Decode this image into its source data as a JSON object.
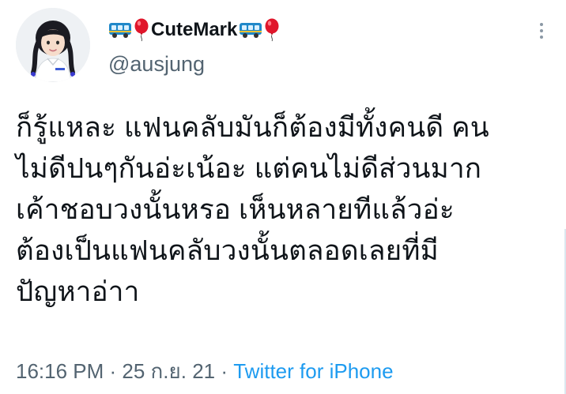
{
  "author": {
    "display_name": "CuteMark",
    "handle": "@ausjung",
    "name_emojis": [
      "bus-icon",
      "balloon-icon"
    ]
  },
  "tweet": {
    "lines": [
      "ก็รู้แหละ แฟนคลับมันก็ต้องมีทั้งคนดี คน",
      "ไม่ดีปนๆกันอ่ะเน้อะ แต่คนไม่ดีส่วนมาก",
      "เค้าชอบวงนั้นหรอ เห็นหลายทีแล้วอ่ะ",
      "ต้องเป็นแฟนคลับวงนั้นตลอดเลยที่มี",
      "ปัญหาอ่าา"
    ]
  },
  "meta": {
    "time": "16:16 PM",
    "separator": " · ",
    "date": "25 ก.ย. 21",
    "source": "Twitter for iPhone"
  },
  "colors": {
    "text": "#0f1419",
    "secondary": "#536471",
    "link": "#1d9bf0",
    "balloon": "#e0162b",
    "bus": "#1f88c9"
  }
}
